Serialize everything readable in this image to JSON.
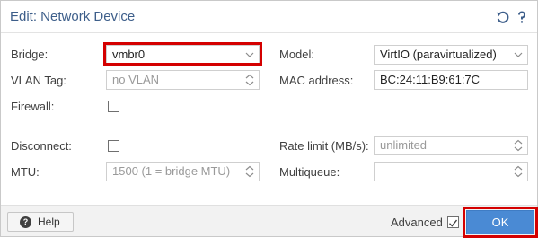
{
  "dialog": {
    "title": "Edit: Network Device",
    "icons": {
      "reset": "reset-icon",
      "help_tool": "help-tool-icon"
    }
  },
  "form": {
    "bridge": {
      "label": "Bridge:",
      "value": "vmbr0"
    },
    "vlan_tag": {
      "label": "VLAN Tag:",
      "placeholder": "no VLAN"
    },
    "firewall": {
      "label": "Firewall:",
      "checked": false
    },
    "model": {
      "label": "Model:",
      "value": "VirtIO (paravirtualized)"
    },
    "mac_address": {
      "label": "MAC address:",
      "value": "BC:24:11:B9:61:7C"
    },
    "disconnect": {
      "label": "Disconnect:",
      "checked": false
    },
    "mtu": {
      "label": "MTU:",
      "placeholder": "1500 (1 = bridge MTU)"
    },
    "rate_limit": {
      "label": "Rate limit (MB/s):",
      "placeholder": "unlimited"
    },
    "multiqueue": {
      "label": "Multiqueue:",
      "value": ""
    }
  },
  "footer": {
    "help_label": "Help",
    "advanced_label": "Advanced",
    "advanced_checked": true,
    "ok_label": "OK"
  },
  "colors": {
    "accent": "#4a8ad4",
    "title": "#3d5e8a",
    "highlight": "#d40000"
  }
}
